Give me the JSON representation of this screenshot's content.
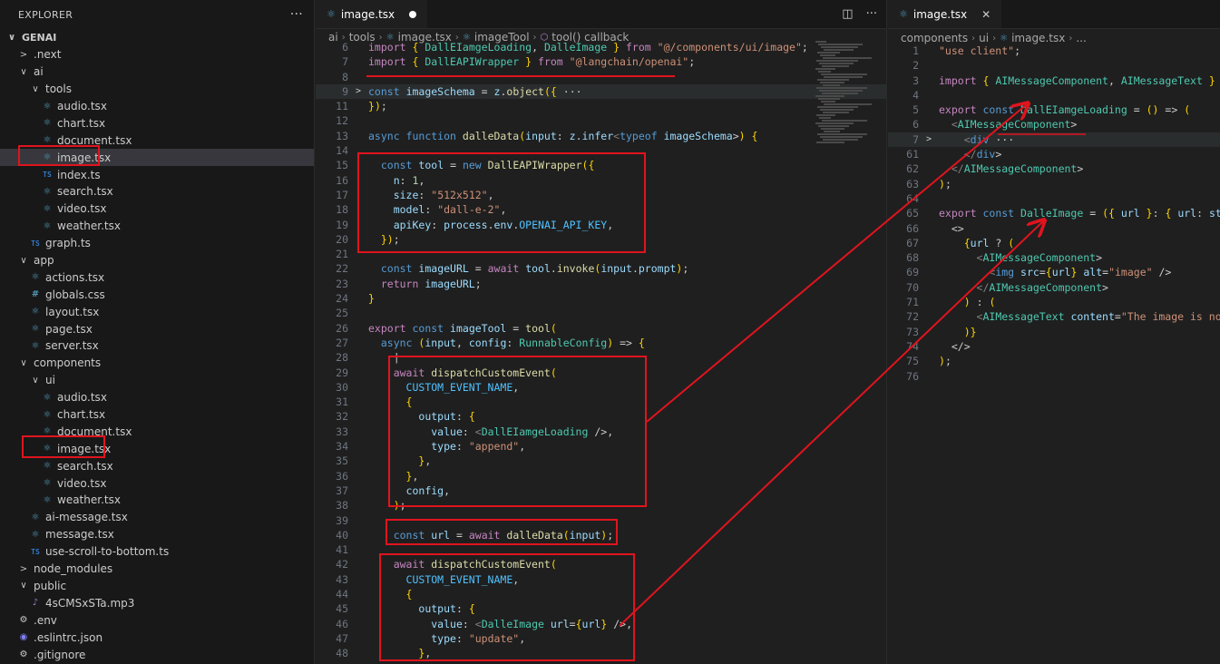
{
  "explorer": {
    "title": "EXPLORER",
    "more": "···",
    "items": [
      {
        "label": "GENAI",
        "depth": 0,
        "type": "root",
        "chev": "∨"
      },
      {
        "label": ".next",
        "depth": 1,
        "type": "folder",
        "chev": ">"
      },
      {
        "label": "ai",
        "depth": 1,
        "type": "folder",
        "chev": "∨"
      },
      {
        "label": "tools",
        "depth": 2,
        "type": "folder",
        "chev": "∨"
      },
      {
        "label": "audio.tsx",
        "depth": 3,
        "type": "react"
      },
      {
        "label": "chart.tsx",
        "depth": 3,
        "type": "react"
      },
      {
        "label": "document.tsx",
        "depth": 3,
        "type": "react"
      },
      {
        "label": "image.tsx",
        "depth": 3,
        "type": "react",
        "selected": true
      },
      {
        "label": "index.ts",
        "depth": 3,
        "type": "ts"
      },
      {
        "label": "search.tsx",
        "depth": 3,
        "type": "react"
      },
      {
        "label": "video.tsx",
        "depth": 3,
        "type": "react"
      },
      {
        "label": "weather.tsx",
        "depth": 3,
        "type": "react"
      },
      {
        "label": "graph.ts",
        "depth": 2,
        "type": "ts"
      },
      {
        "label": "app",
        "depth": 1,
        "type": "folder",
        "chev": "∨"
      },
      {
        "label": "actions.tsx",
        "depth": 2,
        "type": "react"
      },
      {
        "label": "globals.css",
        "depth": 2,
        "type": "css"
      },
      {
        "label": "layout.tsx",
        "depth": 2,
        "type": "react"
      },
      {
        "label": "page.tsx",
        "depth": 2,
        "type": "react"
      },
      {
        "label": "server.tsx",
        "depth": 2,
        "type": "react"
      },
      {
        "label": "components",
        "depth": 1,
        "type": "folder",
        "chev": "∨"
      },
      {
        "label": "ui",
        "depth": 2,
        "type": "folder",
        "chev": "∨"
      },
      {
        "label": "audio.tsx",
        "depth": 3,
        "type": "react"
      },
      {
        "label": "chart.tsx",
        "depth": 3,
        "type": "react"
      },
      {
        "label": "document.tsx",
        "depth": 3,
        "type": "react"
      },
      {
        "label": "image.tsx",
        "depth": 3,
        "type": "react"
      },
      {
        "label": "search.tsx",
        "depth": 3,
        "type": "react"
      },
      {
        "label": "video.tsx",
        "depth": 3,
        "type": "react"
      },
      {
        "label": "weather.tsx",
        "depth": 3,
        "type": "react"
      },
      {
        "label": "ai-message.tsx",
        "depth": 2,
        "type": "react"
      },
      {
        "label": "message.tsx",
        "depth": 2,
        "type": "react"
      },
      {
        "label": "use-scroll-to-bottom.ts",
        "depth": 2,
        "type": "ts"
      },
      {
        "label": "node_modules",
        "depth": 1,
        "type": "folder",
        "chev": ">"
      },
      {
        "label": "public",
        "depth": 1,
        "type": "folder",
        "chev": "∨"
      },
      {
        "label": "4sCMSxSTa.mp3",
        "depth": 2,
        "type": "mp3"
      },
      {
        "label": ".env",
        "depth": 1,
        "type": "env"
      },
      {
        "label": ".eslintrc.json",
        "depth": 1,
        "type": "eslint"
      },
      {
        "label": ".gitignore",
        "depth": 1,
        "type": "env"
      }
    ]
  },
  "editor_left": {
    "tab_label": "image.tsx",
    "breadcrumb": [
      "ai",
      "tools",
      "image.tsx",
      "imageTool",
      "tool() callback"
    ],
    "lines": [
      {
        "n": "6",
        "text": "import { DallEIamgeLoading, DalleImage } from \"@/components/ui/image\";"
      },
      {
        "n": "7",
        "text": "import { DallEAPIWrapper } from \"@langchain/openai\";"
      },
      {
        "n": "8",
        "text": ""
      },
      {
        "n": "9",
        "text": "const imageSchema = z.object({ ···",
        "fold": ">",
        "hl": true
      },
      {
        "n": "11",
        "text": "});"
      },
      {
        "n": "12",
        "text": ""
      },
      {
        "n": "13",
        "text": "async function dalleData(input: z.infer<typeof imageSchema>) {"
      },
      {
        "n": "14",
        "text": ""
      },
      {
        "n": "15",
        "text": "  const tool = new DallEAPIWrapper({"
      },
      {
        "n": "16",
        "text": "    n: 1,"
      },
      {
        "n": "17",
        "text": "    size: \"512x512\","
      },
      {
        "n": "18",
        "text": "    model: \"dall-e-2\","
      },
      {
        "n": "19",
        "text": "    apiKey: process.env.OPENAI_API_KEY,"
      },
      {
        "n": "20",
        "text": "  });"
      },
      {
        "n": "21",
        "text": ""
      },
      {
        "n": "22",
        "text": "  const imageURL = await tool.invoke(input.prompt);"
      },
      {
        "n": "23",
        "text": "  return imageURL;"
      },
      {
        "n": "24",
        "text": "}"
      },
      {
        "n": "25",
        "text": ""
      },
      {
        "n": "26",
        "text": "export const imageTool = tool("
      },
      {
        "n": "27",
        "text": "  async (input, config: RunnableConfig) => {"
      },
      {
        "n": "28",
        "text": "    |"
      },
      {
        "n": "29",
        "text": "    await dispatchCustomEvent("
      },
      {
        "n": "30",
        "text": "      CUSTOM_EVENT_NAME,"
      },
      {
        "n": "31",
        "text": "      {"
      },
      {
        "n": "32",
        "text": "        output: {"
      },
      {
        "n": "33",
        "text": "          value: <DallEIamgeLoading />,"
      },
      {
        "n": "34",
        "text": "          type: \"append\","
      },
      {
        "n": "35",
        "text": "        },"
      },
      {
        "n": "36",
        "text": "      },"
      },
      {
        "n": "37",
        "text": "      config,"
      },
      {
        "n": "38",
        "text": "    );"
      },
      {
        "n": "39",
        "text": ""
      },
      {
        "n": "40",
        "text": "    const url = await dalleData(input);"
      },
      {
        "n": "41",
        "text": ""
      },
      {
        "n": "42",
        "text": "    await dispatchCustomEvent("
      },
      {
        "n": "43",
        "text": "      CUSTOM_EVENT_NAME,"
      },
      {
        "n": "44",
        "text": "      {"
      },
      {
        "n": "45",
        "text": "        output: {"
      },
      {
        "n": "46",
        "text": "          value: <DalleImage url={url} />,"
      },
      {
        "n": "47",
        "text": "          type: \"update\","
      },
      {
        "n": "48",
        "text": "        },"
      }
    ]
  },
  "editor_right": {
    "tab_label": "image.tsx",
    "breadcrumb": [
      "components",
      "ui",
      "image.tsx",
      "..."
    ],
    "lines": [
      {
        "n": "1",
        "text": "\"use client\";"
      },
      {
        "n": "2",
        "text": ""
      },
      {
        "n": "3",
        "text": "import { AIMessageComponent, AIMessageText } fr"
      },
      {
        "n": "4",
        "text": ""
      },
      {
        "n": "5",
        "text": "export const DallEIamgeLoading = () => ("
      },
      {
        "n": "6",
        "text": "  <AIMessageComponent>"
      },
      {
        "n": "7",
        "text": "    <div ···",
        "fold": ">",
        "hl": true
      },
      {
        "n": "61",
        "text": "    </div>"
      },
      {
        "n": "62",
        "text": "  </AIMessageComponent>"
      },
      {
        "n": "63",
        "text": ");"
      },
      {
        "n": "64",
        "text": ""
      },
      {
        "n": "65",
        "text": "export const DalleImage = ({ url }: { url: stri"
      },
      {
        "n": "66",
        "text": "  <>"
      },
      {
        "n": "67",
        "text": "    {url ? ("
      },
      {
        "n": "68",
        "text": "      <AIMessageComponent>"
      },
      {
        "n": "69",
        "text": "        <img src={url} alt=\"image\" />"
      },
      {
        "n": "70",
        "text": "      </AIMessageComponent>"
      },
      {
        "n": "71",
        "text": "    ) : ("
      },
      {
        "n": "72",
        "text": "      <AIMessageText content=\"The image is not"
      },
      {
        "n": "73",
        "text": "    )}"
      },
      {
        "n": "74",
        "text": "  </>"
      },
      {
        "n": "75",
        "text": ");"
      },
      {
        "n": "76",
        "text": ""
      }
    ]
  },
  "colors": {
    "annotation": "#e0141e",
    "background": "#1f1f1f",
    "sidebar": "#181818"
  }
}
